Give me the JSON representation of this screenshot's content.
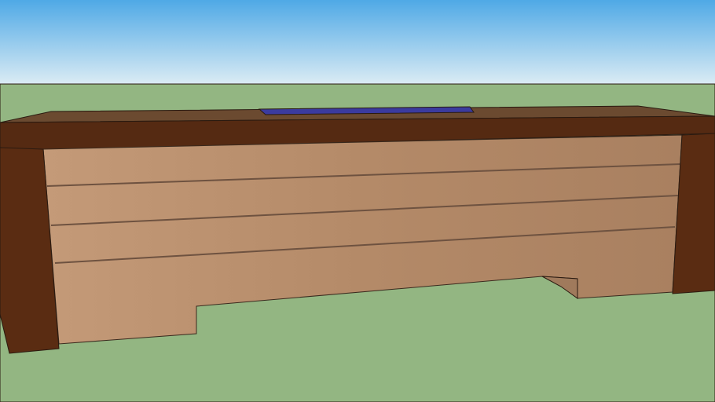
{
  "scene": {
    "subject": "desk-3d-model",
    "colors": {
      "sky_top": "#4fa9e6",
      "sky_bottom": "#dcecf4",
      "ground": "#93b682",
      "top_surface": "#6b4a30",
      "edge_band": "#552a12",
      "leg": "#5a2c12",
      "panel": "#b88e6c",
      "groove": "#6e5240",
      "glass": "#3b3b9e",
      "cutout_side": "#a07a5c"
    }
  }
}
